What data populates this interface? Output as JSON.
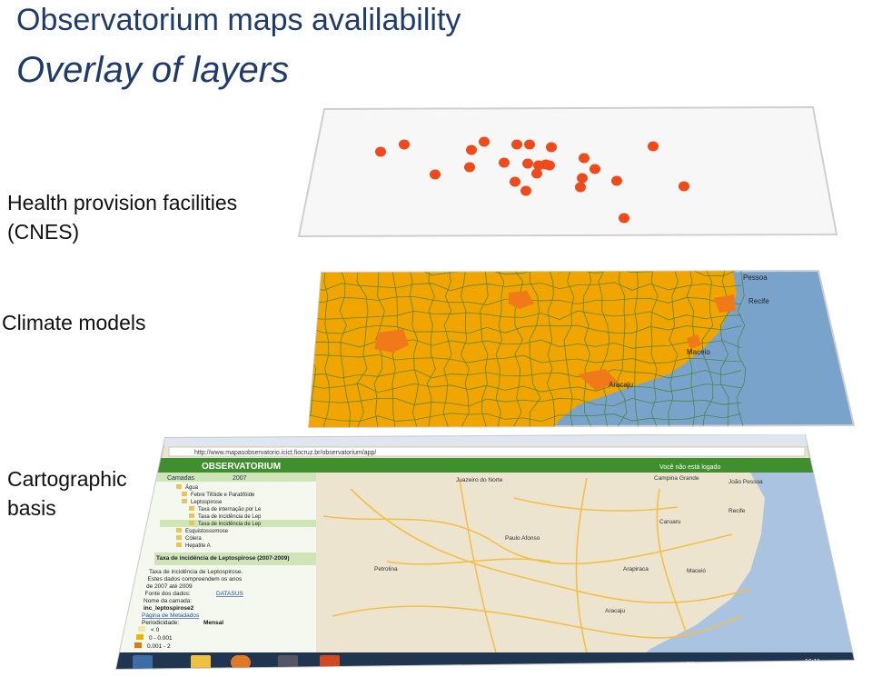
{
  "slide": {
    "title": "Observatorium maps avalilability",
    "subtitle": "Overlay of layers"
  },
  "labels": {
    "health": "Health  provision facilities",
    "health_line2": "(CNES)",
    "climate": "Climate  models",
    "carto": "Cartographic",
    "carto_line2": "basis"
  },
  "health_layer": {
    "point_color": "#f04a1a",
    "point_count": 25
  },
  "climate_layer": {
    "land_color": "#f0a500",
    "highlight_color": "#f07a1a",
    "sea_color": "#7aa3cc",
    "city_labels": [
      "Pessoa",
      "Recife",
      "Maceio",
      "Aracaju"
    ]
  },
  "carto_layer": {
    "browser_url": "http://www.mapasobservatorio.icict.fiocruz.br/observatorium/app/",
    "logo": "OBSERVATORIUM",
    "panel_header": "Camadas",
    "panel_year": "2007",
    "tree_items": [
      "Água",
      "Febre Tifóide e Paratifóide",
      "Leptospirose",
      "Taxa de internação por Le",
      "Taxa de incidência de Lep",
      "Taxa de incidência de Lep",
      "Esquistossomose",
      "Cólera",
      "Hepatite A"
    ],
    "info_title": "Taxa de incidência de Leptospirose (2007-2009)",
    "info_lines": [
      "Taxa de incidência de Leptospirose.",
      "Estes dados compreendem os anos",
      "de 2007 até 2009",
      "Fonte dos dados:",
      "Nome da camada:"
    ],
    "info_link_datasus": "DATASUS",
    "info_layer_name": "inc_leptospirose2",
    "info_metadata_link": "Página de Metadados",
    "info_periodicity": "Periodicidade:",
    "info_periodicity_value": "Mensal",
    "legend": [
      "< 0",
      "0 - 0.001",
      "0.001 - 2"
    ],
    "login_text": "Você não está logado",
    "map_cities": [
      "Juazeiro do Norte",
      "Campina Grande",
      "João Pessoa",
      "Recife",
      "Caruaru",
      "Petrolina",
      "Maceió",
      "Arapiraca",
      "Aracaju",
      "Paulo Afonso"
    ],
    "taskbar_lang": "PT",
    "taskbar_time": "16:11",
    "colors": {
      "header_green": "#3f8f2f",
      "panel_green": "#cfe5b8",
      "map_land": "#ece4cf",
      "map_sea": "#a9c3e0",
      "road": "#f2c04a"
    }
  }
}
